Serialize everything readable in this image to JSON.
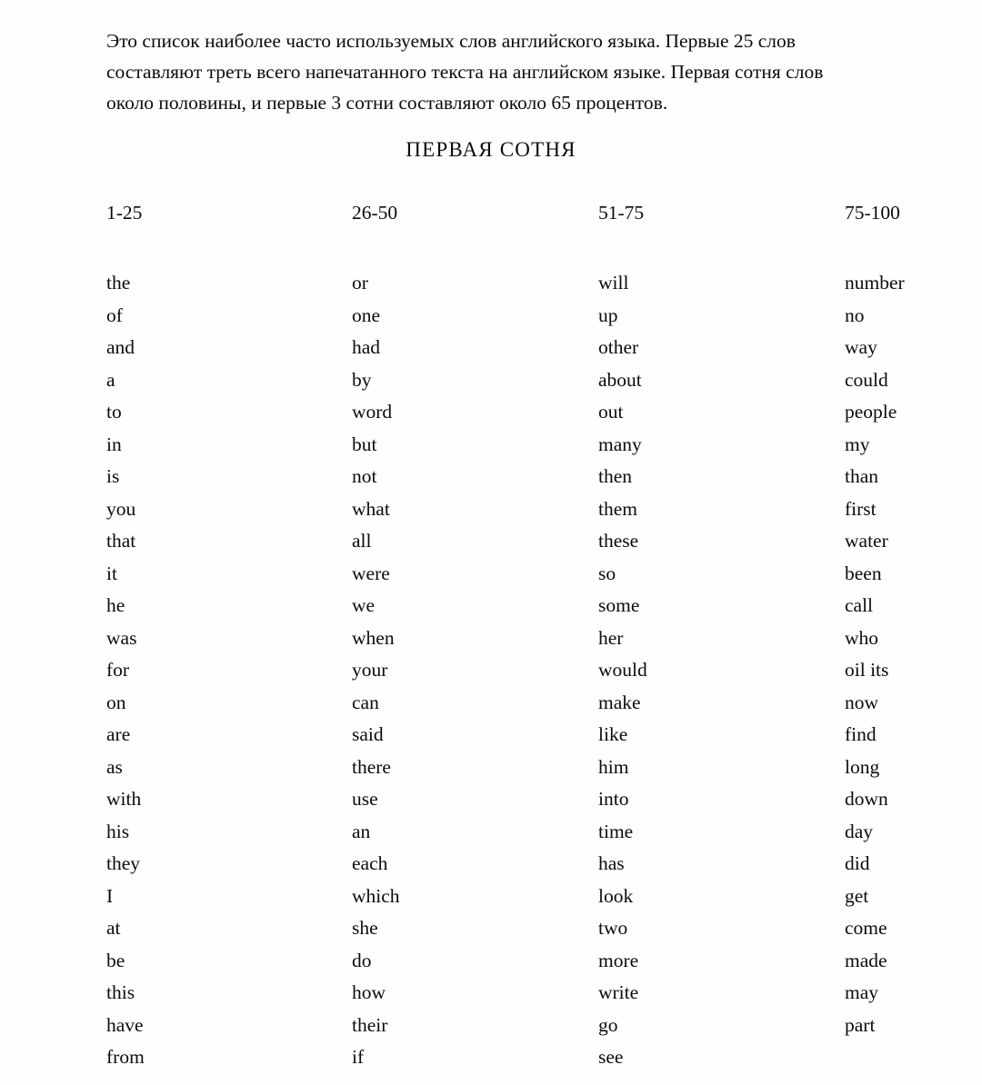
{
  "document": {
    "intro_lines": [
      "Это список наиболее часто используемых слов английского языка.  Первые 25 слов",
      "составляют треть всего напечатанного текста на английском языке.  Первая сотня слов",
      "около половины, и первые 3 сотни составляют около 65 процентов."
    ],
    "section_title": "ПЕРВАЯ СОТНЯ",
    "column_headers": [
      "1-25",
      "26-50",
      "51-75",
      "75-100"
    ],
    "columns": [
      [
        "the",
        "of",
        "and",
        "a",
        "to",
        "in",
        "is",
        "you",
        "that",
        "it",
        "he",
        "was",
        "for",
        "on",
        "are",
        "as",
        "with",
        "his",
        "they",
        "I",
        "at",
        "be",
        "this",
        "have",
        "from"
      ],
      [
        "or",
        "one",
        "had",
        "by",
        "word",
        "but",
        "not",
        "what",
        "all",
        "were",
        "we",
        "when",
        "your",
        "can",
        "said",
        "there",
        "use",
        "an",
        "each",
        "which",
        "she",
        "do",
        "how",
        "their",
        "if"
      ],
      [
        "will",
        "up",
        "other",
        "about",
        "out",
        "many",
        "then",
        "them",
        "these",
        "so",
        "some",
        "her",
        "would",
        "make",
        "like",
        "him",
        "into",
        "time",
        "has",
        "look",
        "two",
        "more",
        "write",
        "go",
        "see"
      ],
      [
        "number",
        "no",
        "way",
        "could",
        "people",
        "my",
        "than",
        "first",
        "water",
        "been",
        "call",
        "who",
        "oil its",
        "now",
        "find",
        "long",
        "down",
        "day",
        "did",
        "get",
        "come",
        "made",
        "may",
        "part"
      ]
    ]
  },
  "colors": {
    "page_background": "#fefefe",
    "text": "#0c0c0c"
  }
}
